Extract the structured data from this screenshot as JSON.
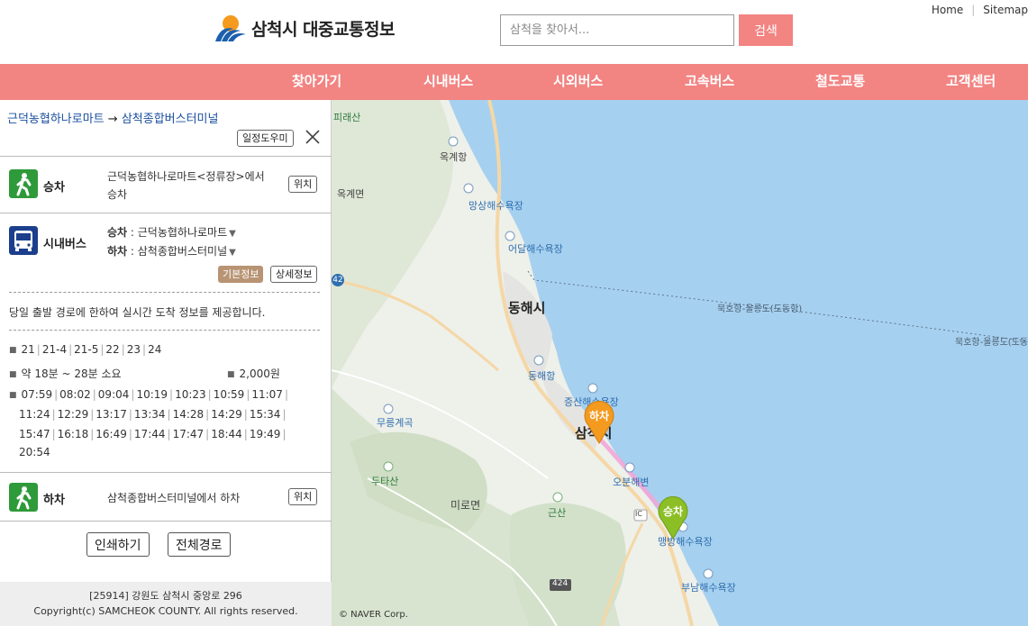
{
  "header": {
    "logo_text": "삼척시 대중교통정보",
    "search_placeholder": "삼척을 찾아서...",
    "search_button": "검색",
    "util_links": [
      "Home",
      "Sitemap"
    ]
  },
  "nav": [
    "찾아가기",
    "시내버스",
    "시외버스",
    "고속버스",
    "철도교통",
    "고객센터"
  ],
  "panel": {
    "route_from": "근덕농협하나로마트",
    "route_arrow": "→",
    "route_to": "삼척종합버스터미널",
    "schedule_help": "일정도우미",
    "board": {
      "label": "승차",
      "text_line1": "근덕농협하나로마트<정류장>에서",
      "text_line2": "승차",
      "location_button": "위치"
    },
    "bus": {
      "label": "시내버스",
      "board_key": "승차",
      "board_value": "근덕농협하나로마트",
      "alight_key": "하차",
      "alight_value": "삼척종합버스터미널",
      "basic_info": "기본정보",
      "detail_info": "상세정보",
      "notice": "당일 출발 경로에 한하여 실시간 도착 정보를 제공합니다.",
      "routes": [
        "21",
        "21-4",
        "21-5",
        "22",
        "23",
        "24"
      ],
      "duration": "약 18분 ~ 28분 소요",
      "fare": "2,000원",
      "times": [
        [
          "07:59",
          "08:02",
          "09:04",
          "10:19",
          "10:23",
          "10:59",
          "11:07"
        ],
        [
          "11:24",
          "12:29",
          "13:17",
          "13:34",
          "14:28",
          "14:29",
          "15:34"
        ],
        [
          "15:47",
          "16:18",
          "16:49",
          "17:44",
          "17:47",
          "18:44",
          "19:49"
        ],
        [
          "20:54"
        ]
      ]
    },
    "alight": {
      "label": "하차",
      "text": "삼척종합버스터미널에서 하차",
      "location_button": "위치"
    },
    "print_button": "인쇄하기",
    "full_route_button": "전체경로",
    "footer_address": "[25914] 강원도 삼척시 중앙로 296",
    "footer_copyright": "Copyright(c) SAMCHEOK COUNTY. All rights reserved."
  },
  "map": {
    "labels": {
      "piraesan": "피래산",
      "okgyehang": "옥계항",
      "okgyemyeon": "옥계면",
      "mangsang": "망상해수욕장",
      "eodal": "어달해수욕장",
      "donghae": "동해시",
      "donghaehang": "동해항",
      "jeungsan": "증산해수욕장",
      "mureung": "무릉계곡",
      "samcheok": "삼척시",
      "obun": "오분해변",
      "dutasan": "두타산",
      "miromyeon": "미로면",
      "geunsan": "근산",
      "maengbang": "맹방해수욕장",
      "bunam": "부남해수욕장",
      "road42": "42",
      "road424": "424",
      "ic": "IC",
      "ferry1": "묵호항-울릉도(도동항)",
      "ferry2": "묵호항-울릉도(도동항)",
      "naver": "© NAVER Corp."
    },
    "marker_alight": "하차",
    "marker_board": "승차",
    "colors": {
      "sea": "#a6d0ef",
      "land": "#eef0ea",
      "marker_alight": "#f39a1f",
      "marker_board": "#8cbf26",
      "route": "#f0a6d8"
    }
  }
}
